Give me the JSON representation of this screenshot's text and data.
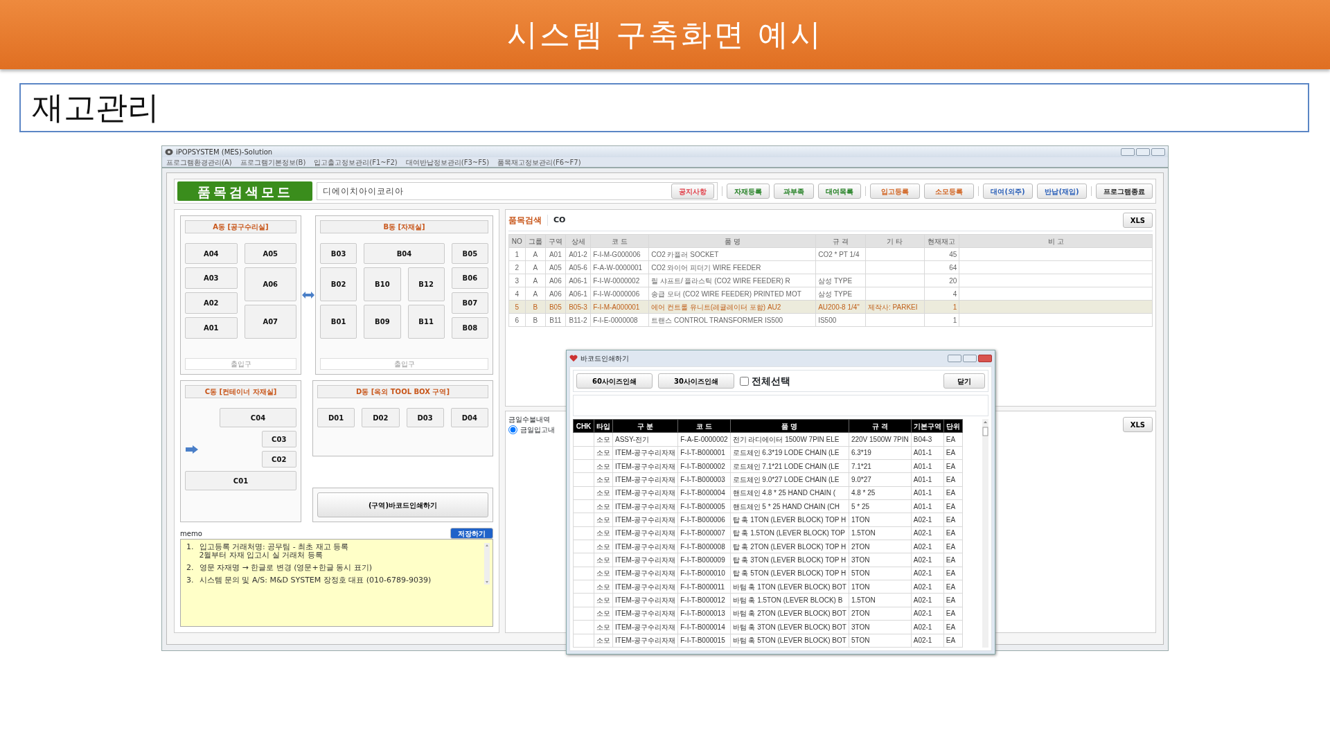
{
  "slide": {
    "title": "시스템 구축화면 예시",
    "subtitle": "재고관리"
  },
  "window": {
    "title": "iPOPSYSTEM (MES)-Solution"
  },
  "menu": [
    "프로그램환경관리(A)",
    "프로그램기본정보(B)",
    "입고출고정보관리(F1~F2)",
    "대여반납정보관리(F3~F5)",
    "품목재고정보관리(F6~F7)"
  ],
  "toolbar": {
    "mode_button": "품목검색모드",
    "company": "디에이치아이코리아",
    "notice_button": "공지사항",
    "buttons": [
      {
        "label": "자재등록",
        "color": "#1e7d1e"
      },
      {
        "label": "과부족",
        "color": "#1e7d1e"
      },
      {
        "label": "대여목록",
        "color": "#1e7d1e"
      },
      {
        "label": "입고등록",
        "color": "#d0601c"
      },
      {
        "label": "소모등록",
        "color": "#d0601c"
      },
      {
        "label": "대여(외주)",
        "color": "#2a5fb8"
      },
      {
        "label": "반납(재입)",
        "color": "#2a5fb8"
      },
      {
        "label": "프로그램종료",
        "color": "#222222"
      }
    ]
  },
  "zones": [
    {
      "title": "A동 [공구수리실]",
      "cells": [
        "A04",
        "A05",
        "A03",
        "A06",
        "A02",
        "A07",
        "A01"
      ],
      "entrance": "출입구"
    },
    {
      "title": "B동 [자재실]",
      "cells": [
        "B03",
        "B04",
        "B05",
        "B02",
        "B10",
        "B12",
        "B06",
        "B07",
        "B01",
        "B09",
        "B11",
        "B08"
      ],
      "entrance": "출입구"
    },
    {
      "title": "C동 [컨테이너 자재실]",
      "cells": [
        "C04",
        "C03",
        "C02",
        "C01"
      ]
    },
    {
      "title": "D동 [옥외 TOOL BOX 구역]",
      "cells": [
        "D01",
        "D02",
        "D03",
        "D04"
      ]
    }
  ],
  "barcode_button": "(구역)바코드인쇄하기",
  "memo": {
    "label": "memo",
    "save_button": "저장하기",
    "items": [
      {
        "number": "1.",
        "lines": [
          "입고등록 거래처명: 공무팀 - 최초 재고 등록",
          "2월부터 자재 입고시 실 거래처 등록"
        ]
      },
      {
        "number": "2.",
        "lines": [
          "영문 자재명  → 한글로 변경 (영문+한글 동시 표기)"
        ]
      },
      {
        "number": "3.",
        "lines": [
          "시스템 문의 및 A/S: M&D SYSTEM 장정호 대표 (010-6789-9039)"
        ]
      }
    ]
  },
  "search": {
    "label": "품목검색",
    "query": "CO",
    "xls_button": "XLS",
    "columns": [
      "NO",
      "그룹",
      "구역",
      "상세",
      "코 드",
      "품 명",
      "규 격",
      "기 타",
      "현재재고",
      "비 고"
    ],
    "rows": [
      {
        "no": "1",
        "group": "A",
        "zone": "A01",
        "detail": "A01-2",
        "code": "F-I-M-G000006",
        "name": "CO2 카플러 SOCKET",
        "spec": "CO2 * PT 1/4",
        "stock": "45",
        "selected": false
      },
      {
        "no": "2",
        "group": "A",
        "zone": "A05",
        "detail": "A05-6",
        "code": "F-A-W-0000001",
        "name": "CO2 와이어 피더기 WIRE FEEDER",
        "stock": "64",
        "selected": false
      },
      {
        "no": "3",
        "group": "A",
        "zone": "A06",
        "detail": "A06-1",
        "code": "F-I-W-0000002",
        "name": "릴 샤프트/ 플라스틱 (CO2 WIRE FEEDER) R",
        "spec": "삼성 TYPE",
        "stock": "20",
        "selected": false
      },
      {
        "no": "4",
        "group": "A",
        "zone": "A06",
        "detail": "A06-1",
        "code": "F-I-W-0000006",
        "name": "송급 모터 (CO2 WIRE FEEDER) PRINTED MOT",
        "spec": "삼성 TYPE",
        "stock": "4",
        "selected": false
      },
      {
        "no": "5",
        "group": "B",
        "zone": "B05",
        "detail": "B05-3",
        "code": "F-I-M-A000001",
        "name": "에어 컨트롤 유니트(레귤레이터 포함) AU2",
        "spec": "AU200-8 1/4\"",
        "etc": "제작사: PARKEI",
        "stock": "1",
        "selected": true
      },
      {
        "no": "6",
        "group": "B",
        "zone": "B11",
        "detail": "B11-2",
        "code": "F-I-E-0000008",
        "name": "트랜스 CONTROL TRANSFORMER IS500",
        "spec": "IS500",
        "stock": "1",
        "selected": false
      }
    ]
  },
  "history": {
    "label": "금일수불내역",
    "radio": {
      "label": "금일입고내",
      "selected": true
    },
    "xls_button": "XLS"
  },
  "dialog": {
    "title": "바코드인쇄하기",
    "print_buttons": [
      "60사이즈인쇄",
      "30사이즈인쇄"
    ],
    "select_all": {
      "label": "전체선택",
      "checked": false
    },
    "close_button": "닫기",
    "columns": [
      "CHK",
      "타입",
      "구 분",
      "코 드",
      "품 명",
      "규 격",
      "기본구역",
      "단위"
    ],
    "rows": [
      [
        "",
        "소모",
        "ASSY-전기",
        "F-A-E-0000002",
        "전기 라디에이터 1500W 7PIN ELE",
        "220V 1500W 7PIN",
        "B04-3",
        "EA"
      ],
      [
        "",
        "소모",
        "ITEM-공구수리자재",
        "F-I-T-B000001",
        "로드체인 6.3*19 LODE CHAIN (LE",
        "6.3*19",
        "A01-1",
        "EA"
      ],
      [
        "",
        "소모",
        "ITEM-공구수리자재",
        "F-I-T-B000002",
        "로드체인 7.1*21 LODE CHAIN (LE",
        "7.1*21",
        "A01-1",
        "EA"
      ],
      [
        "",
        "소모",
        "ITEM-공구수리자재",
        "F-I-T-B000003",
        "로드체인 9.0*27 LODE CHAIN (LE",
        "9.0*27",
        "A01-1",
        "EA"
      ],
      [
        "",
        "소모",
        "ITEM-공구수리자재",
        "F-I-T-B000004",
        "핸드체인 4.8 * 25 HAND CHAIN (",
        "4.8 * 25",
        "A01-1",
        "EA"
      ],
      [
        "",
        "소모",
        "ITEM-공구수리자재",
        "F-I-T-B000005",
        "핸드체인 5 * 25 HAND CHAIN (CH",
        "5 * 25",
        "A01-1",
        "EA"
      ],
      [
        "",
        "소모",
        "ITEM-공구수리자재",
        "F-I-T-B000006",
        "탑 훅 1TON (LEVER BLOCK) TOP H",
        "1TON",
        "A02-1",
        "EA"
      ],
      [
        "",
        "소모",
        "ITEM-공구수리자재",
        "F-I-T-B000007",
        "탑 훅 1.5TON (LEVER BLOCK) TOP",
        "1.5TON",
        "A02-1",
        "EA"
      ],
      [
        "",
        "소모",
        "ITEM-공구수리자재",
        "F-I-T-B000008",
        "탑 훅 2TON (LEVER BLOCK) TOP H",
        "2TON",
        "A02-1",
        "EA"
      ],
      [
        "",
        "소모",
        "ITEM-공구수리자재",
        "F-I-T-B000009",
        "탑 훅 3TON (LEVER BLOCK) TOP H",
        "3TON",
        "A02-1",
        "EA"
      ],
      [
        "",
        "소모",
        "ITEM-공구수리자재",
        "F-I-T-B000010",
        "탑 훅 5TON (LEVER BLOCK) TOP H",
        "5TON",
        "A02-1",
        "EA"
      ],
      [
        "",
        "소모",
        "ITEM-공구수리자재",
        "F-I-T-B000011",
        "바텀 훅 1TON (LEVER BLOCK) BOT",
        "1TON",
        "A02-1",
        "EA"
      ],
      [
        "",
        "소모",
        "ITEM-공구수리자재",
        "F-I-T-B000012",
        "바텀 훅 1.5TON (LEVER BLOCK) B",
        "1.5TON",
        "A02-1",
        "EA"
      ],
      [
        "",
        "소모",
        "ITEM-공구수리자재",
        "F-I-T-B000013",
        "바텀 훅 2TON (LEVER BLOCK) BOT",
        "2TON",
        "A02-1",
        "EA"
      ],
      [
        "",
        "소모",
        "ITEM-공구수리자재",
        "F-I-T-B000014",
        "바텀 훅 3TON (LEVER BLOCK) BOT",
        "3TON",
        "A02-1",
        "EA"
      ],
      [
        "",
        "소모",
        "ITEM-공구수리자재",
        "F-I-T-B000015",
        "바텀 훅 5TON (LEVER BLOCK) BOT",
        "5TON",
        "A02-1",
        "EA"
      ]
    ]
  }
}
